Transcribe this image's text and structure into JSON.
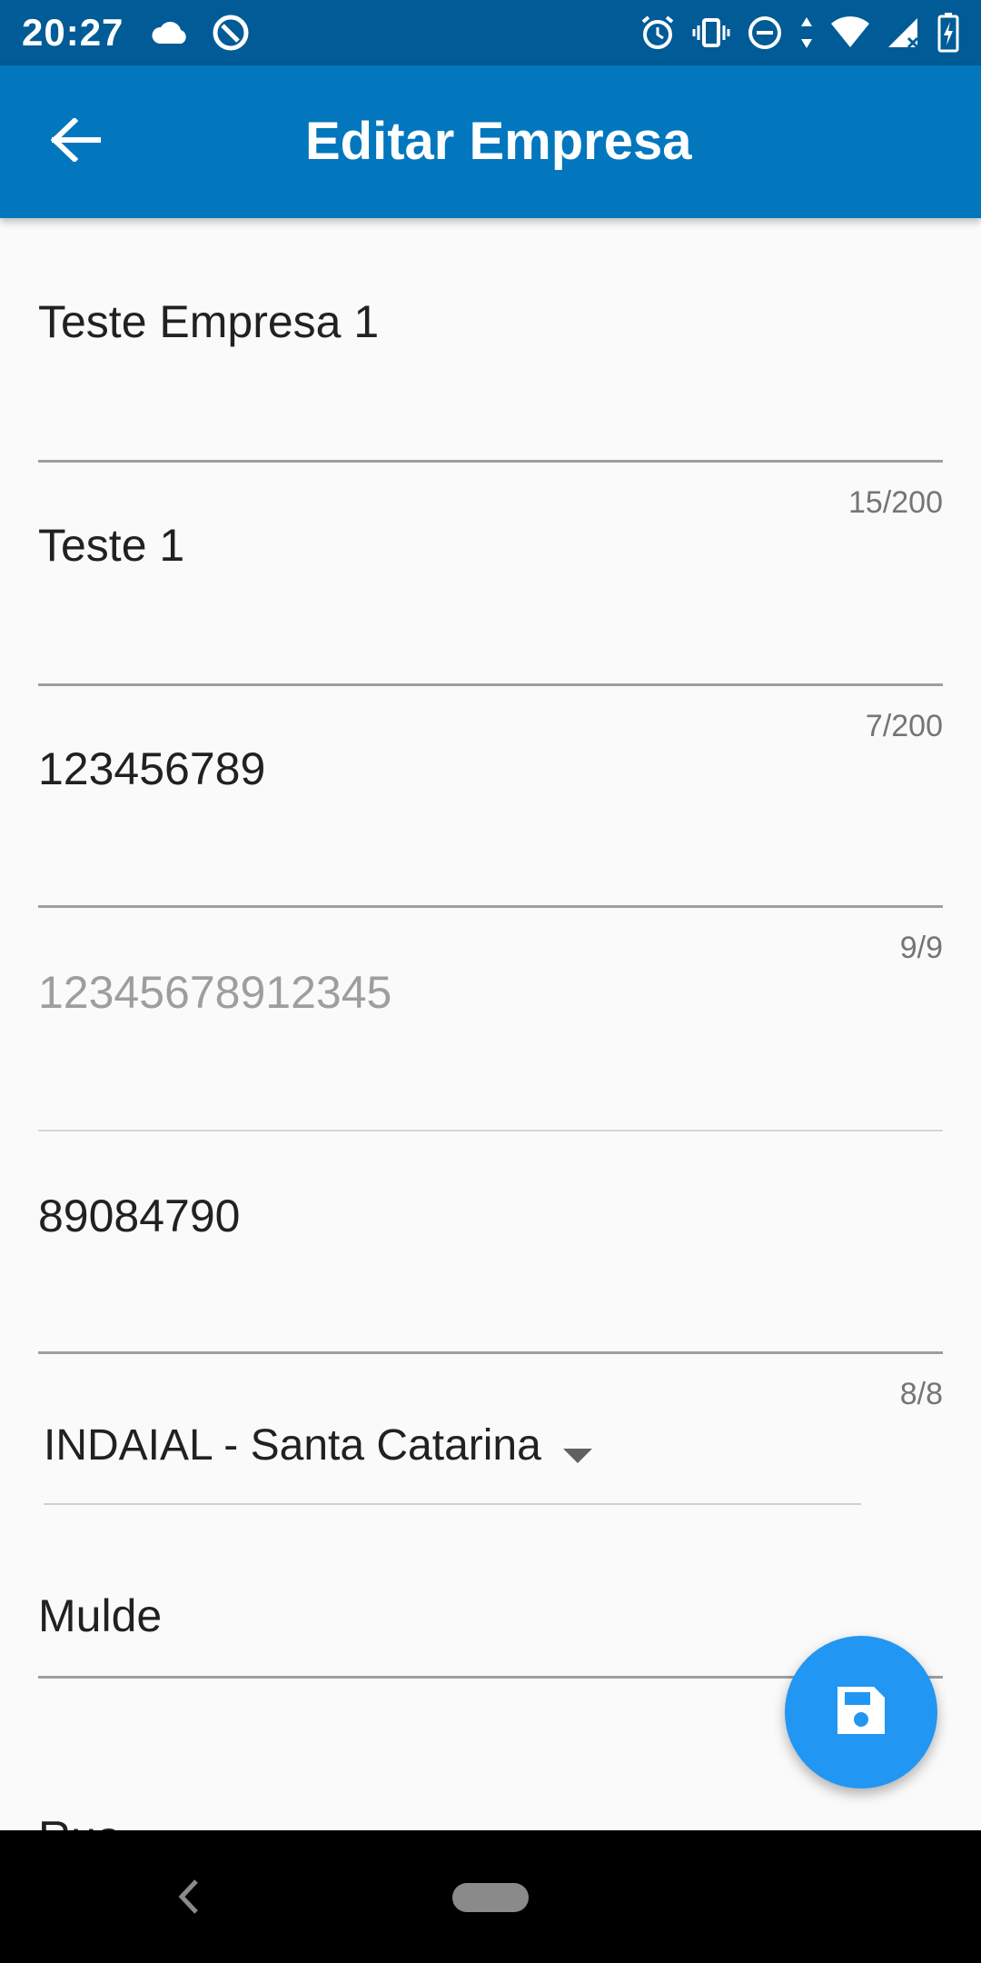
{
  "status_bar": {
    "time": "20:27",
    "icons": [
      "cloud-icon",
      "sync-icon",
      "alarm-icon",
      "vibrate-icon",
      "do-not-disturb-icon",
      "data-arrows-icon",
      "wifi-icon",
      "signal-icon",
      "battery-charging-icon"
    ]
  },
  "app_bar": {
    "title": "Editar Empresa",
    "back_icon": "arrow-back-icon"
  },
  "form": {
    "fields": [
      {
        "value": "Teste Empresa 1",
        "counter": "15/200"
      },
      {
        "value": "Teste 1",
        "counter": "7/200"
      },
      {
        "value": "123456789",
        "counter": "9/9"
      },
      {
        "value": "12345678912345",
        "disabled": true
      },
      {
        "value": "89084790",
        "counter": "8/8"
      },
      {
        "value": "Mulde"
      },
      {
        "value": "Rua"
      }
    ],
    "city_dropdown": {
      "selected": "INDAIAL - Santa Catarina"
    }
  },
  "fab": {
    "icon": "save-icon"
  },
  "colors": {
    "status_bar": "#005b96",
    "app_bar": "#0277bd",
    "fab": "#2196f3",
    "background": "#fafafa"
  }
}
